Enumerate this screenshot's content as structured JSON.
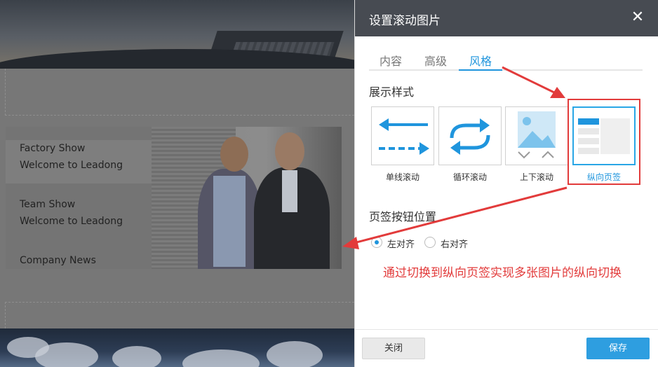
{
  "background_page": {
    "tabs": [
      {
        "line1": "Factory Show",
        "line2": "Welcome to Leadong"
      },
      {
        "line1": "Team Show",
        "line2": "Welcome to Leadong"
      },
      {
        "line1": "Company News",
        "line2": ""
      }
    ]
  },
  "dialog": {
    "title": "设置滚动图片",
    "close_symbol": "✕",
    "tabs": [
      {
        "label": "内容"
      },
      {
        "label": "高级"
      },
      {
        "label": "风格"
      }
    ],
    "active_tab": "风格",
    "display_style": {
      "title": "展示样式",
      "options": [
        {
          "label": "单线滚动",
          "icon": "single-line-scroll-icon"
        },
        {
          "label": "循环滚动",
          "icon": "loop-scroll-icon"
        },
        {
          "label": "上下滚动",
          "icon": "vertical-scroll-icon"
        },
        {
          "label": "纵向页签",
          "icon": "vertical-tabs-icon"
        }
      ],
      "selected": "纵向页签"
    },
    "tab_button_position": {
      "title": "页签按钮位置",
      "options": [
        {
          "label": "左对齐",
          "checked": true
        },
        {
          "label": "右对齐",
          "checked": false
        }
      ]
    },
    "annotation": "通过切换到纵向页签实现多张图片的纵向切换",
    "footer": {
      "close_label": "关闭",
      "save_label": "保存"
    }
  },
  "colors": {
    "accent": "#1f95dd",
    "annotation_red": "#e23b3b",
    "header_bg": "#474b52"
  }
}
